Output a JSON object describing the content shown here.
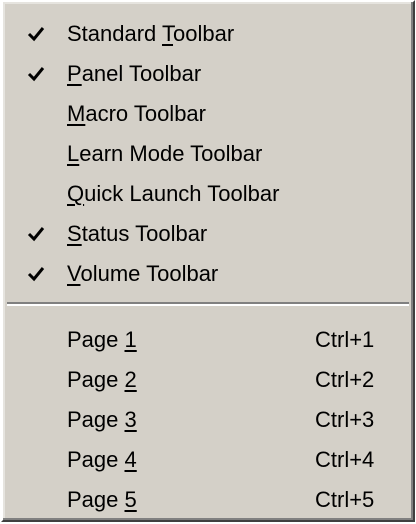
{
  "menu": {
    "toolbar_items": [
      {
        "before": "Standard ",
        "accel": "T",
        "after": "oolbar",
        "checked": true
      },
      {
        "before": "",
        "accel": "P",
        "after": "anel Toolbar",
        "checked": true
      },
      {
        "before": "",
        "accel": "M",
        "after": "acro Toolbar",
        "checked": false
      },
      {
        "before": "",
        "accel": "L",
        "after": "earn Mode Toolbar",
        "checked": false
      },
      {
        "before": "",
        "accel": "Q",
        "after": "uick Launch Toolbar",
        "checked": false
      },
      {
        "before": "",
        "accel": "S",
        "after": "tatus Toolbar",
        "checked": true
      },
      {
        "before": "",
        "accel": "V",
        "after": "olume Toolbar",
        "checked": true
      }
    ],
    "page_items": [
      {
        "before": "Page ",
        "accel": "1",
        "shortcut": "Ctrl+1"
      },
      {
        "before": "Page ",
        "accel": "2",
        "shortcut": "Ctrl+2"
      },
      {
        "before": "Page ",
        "accel": "3",
        "shortcut": "Ctrl+3"
      },
      {
        "before": "Page ",
        "accel": "4",
        "shortcut": "Ctrl+4"
      },
      {
        "before": "Page ",
        "accel": "5",
        "shortcut": "Ctrl+5"
      }
    ],
    "colors": {
      "background": "#d4d0c8",
      "text": "#000000"
    },
    "icons": {
      "check": "check-icon"
    }
  }
}
